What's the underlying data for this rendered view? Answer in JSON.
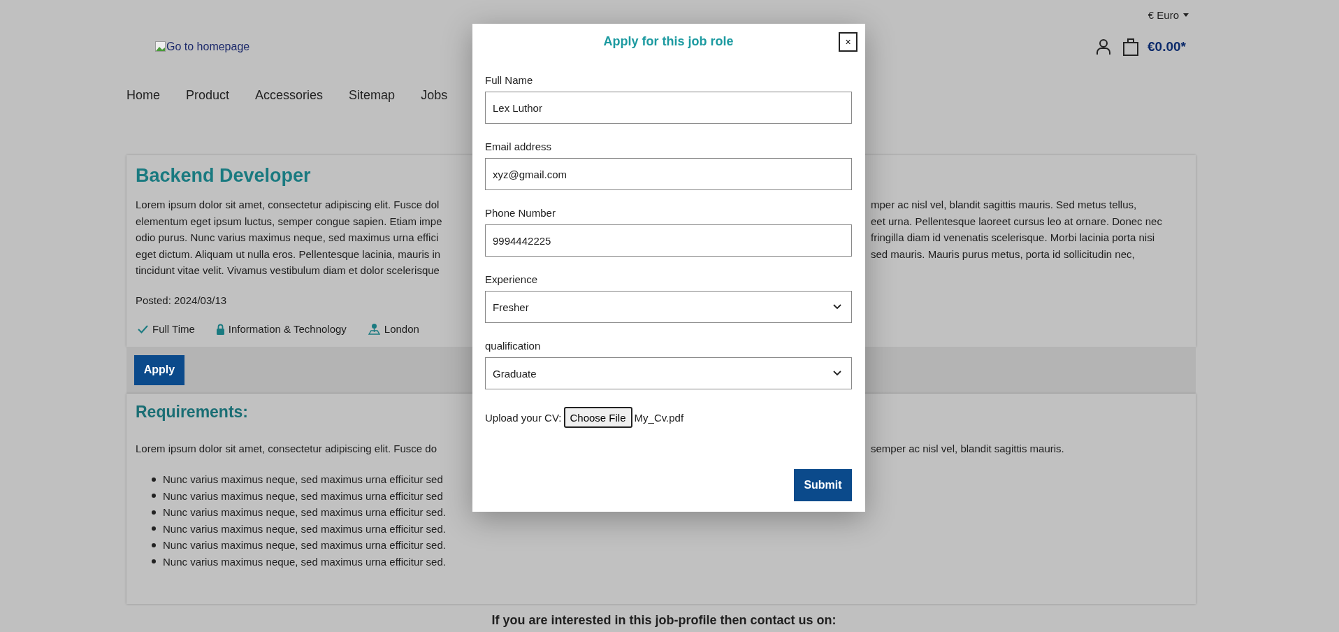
{
  "currency": {
    "label": "€ Euro"
  },
  "logo": {
    "alt": "Go to homepage"
  },
  "nav": [
    "Home",
    "Product",
    "Accessories",
    "Sitemap",
    "Jobs"
  ],
  "cart": {
    "total": "€0.00*"
  },
  "job": {
    "title": "Backend Developer",
    "description_lines": [
      {
        "left": "Lorem ipsum dolor sit amet, consectetur adipiscing elit. Fusce dol",
        "right": "mper ac nisl vel, blandit sagittis mauris. Sed metus tellus,"
      },
      {
        "left": "elementum eget ipsum luctus, semper congue sapien. Etiam impe",
        "right": "eet urna. Pellentesque laoreet cursus leo at ornare. Donec nec"
      },
      {
        "left": "odio purus. Nunc varius maximus neque, sed maximus urna effici",
        "right": "fringilla diam id venenatis scelerisque. Morbi lacinia porta nisi"
      },
      {
        "left": "eget dictum. Aliquam ut nulla eros. Pellentesque lacinia, mauris in",
        "right": "sed mauris. Mauris purus metus, porta id sollicitudin nec,"
      },
      {
        "left": "tincidunt vitae velit. Vivamus vestibulum diam et dolor scelerisque"
      }
    ],
    "posted": "Posted: 2024/03/13",
    "tags": [
      {
        "kind": "type",
        "label": "Full Time"
      },
      {
        "kind": "category",
        "label": "Information & Technology"
      },
      {
        "kind": "location",
        "label": "London"
      }
    ],
    "apply_button": "Apply"
  },
  "requirements": {
    "heading": "Requirements:",
    "intro": {
      "left": "Lorem ipsum dolor sit amet, consectetur adipiscing elit. Fusce do",
      "right": "semper ac nisl vel, blandit sagittis mauris."
    },
    "items": [
      "Nunc varius maximus neque, sed maximus urna efficitur sed",
      "Nunc varius maximus neque, sed maximus urna efficitur sed",
      "Nunc varius maximus neque, sed maximus urna efficitur sed.",
      "Nunc varius maximus neque, sed maximus urna efficitur sed.",
      "Nunc varius maximus neque, sed maximus urna efficitur sed.",
      "Nunc varius maximus neque, sed maximus urna efficitur sed."
    ]
  },
  "contact_heading": "If you are interested in this job-profile then contact us on:",
  "modal": {
    "title": "Apply for this job role",
    "close": "×",
    "fields": [
      {
        "kind": "text",
        "label": "Full Name",
        "value": "Lex Luthor"
      },
      {
        "kind": "text",
        "label": "Email address",
        "value": "xyz@gmail.com"
      },
      {
        "kind": "text",
        "label": "Phone Number",
        "value": "9994442225"
      },
      {
        "kind": "select",
        "label": "Experience",
        "value": "Fresher"
      },
      {
        "kind": "select",
        "label": "qualification",
        "value": "Graduate"
      }
    ],
    "upload": {
      "label": "Upload your CV:",
      "button": "Choose File",
      "file": "My_Cv.pdf"
    },
    "submit": "Submit"
  }
}
